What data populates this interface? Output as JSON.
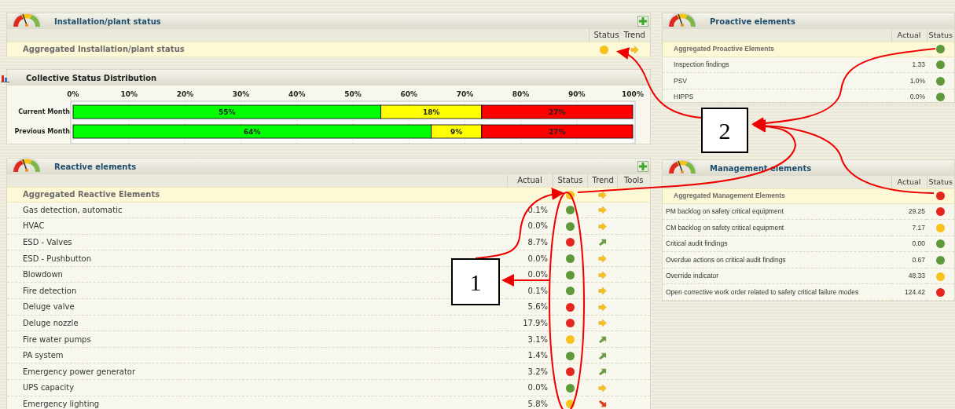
{
  "installation": {
    "title": "Installation/plant status",
    "columns": [
      "Status",
      "Trend"
    ],
    "rows": [
      {
        "name": "Aggregated Installation/plant status",
        "color": "#f7c21b",
        "trend": {
          "kind": "right"
        }
      }
    ]
  },
  "distribution": {
    "title": "Collective Status Distribution",
    "chart_data": {
      "type": "bar",
      "orientation": "horizontal",
      "stacked": true,
      "grid": true,
      "categories": [
        "Current Month",
        "Previous Month"
      ],
      "series": [
        {
          "color": "#00ff00",
          "values": [
            55,
            64
          ]
        },
        {
          "color": "#ffff00",
          "values": [
            18,
            9
          ]
        },
        {
          "color": "#ff0000",
          "values": [
            27,
            27
          ]
        }
      ],
      "xlim": [
        0,
        100
      ],
      "xticks": [
        {
          "value": 0,
          "label": "0%"
        },
        {
          "value": 10,
          "label": "10%"
        },
        {
          "value": 20,
          "label": "20%"
        },
        {
          "value": 30,
          "label": "30%"
        },
        {
          "value": 40,
          "label": "40%"
        },
        {
          "value": 50,
          "label": "50%"
        },
        {
          "value": 60,
          "label": "60%"
        },
        {
          "value": 70,
          "label": "70%"
        },
        {
          "value": 80,
          "label": "80%"
        },
        {
          "value": 90,
          "label": "90%"
        },
        {
          "value": 100,
          "label": "100%"
        }
      ],
      "value_labels": [
        [
          "55%",
          "64%"
        ],
        [
          "18%",
          "9%"
        ],
        [
          "27%",
          "27%"
        ]
      ]
    }
  },
  "reactive": {
    "title": "Reactive elements",
    "columns": [
      "Actual",
      "Status",
      "Trend",
      "Tools"
    ],
    "aggregate": {
      "name": "Aggregated Reactive Elements",
      "color": "#f7c21b",
      "trend": {
        "kind": "right"
      }
    },
    "rows": [
      {
        "name": "Gas detection, automatic",
        "actual": "0.1%",
        "color": "#5e9a3a",
        "trend": {
          "kind": "right"
        }
      },
      {
        "name": "HVAC",
        "actual": "0.0%",
        "color": "#5e9a3a",
        "trend": {
          "kind": "right"
        }
      },
      {
        "name": "ESD - Valves",
        "actual": "8.7%",
        "color": "#e5261c",
        "trend": {
          "kind": "up"
        }
      },
      {
        "name": "ESD - Pushbutton",
        "actual": "0.0%",
        "color": "#5e9a3a",
        "trend": {
          "kind": "right"
        }
      },
      {
        "name": "Blowdown",
        "actual": "0.0%",
        "color": "#5e9a3a",
        "trend": {
          "kind": "right"
        }
      },
      {
        "name": "Fire detection",
        "actual": "0.1%",
        "color": "#5e9a3a",
        "trend": {
          "kind": "right"
        }
      },
      {
        "name": "Deluge valve",
        "actual": "5.6%",
        "color": "#e5261c",
        "trend": {
          "kind": "right"
        }
      },
      {
        "name": "Deluge nozzle",
        "actual": "17.9%",
        "color": "#e5261c",
        "trend": {
          "kind": "right"
        }
      },
      {
        "name": "Fire water pumps",
        "actual": "3.1%",
        "color": "#f7c21b",
        "trend": {
          "kind": "up"
        }
      },
      {
        "name": "PA system",
        "actual": "1.4%",
        "color": "#5e9a3a",
        "trend": {
          "kind": "up"
        }
      },
      {
        "name": "Emergency power generator",
        "actual": "3.2%",
        "color": "#e5261c",
        "trend": {
          "kind": "up"
        }
      },
      {
        "name": "UPS capacity",
        "actual": "0.0%",
        "color": "#5e9a3a",
        "trend": {
          "kind": "right"
        }
      },
      {
        "name": "Emergency lighting",
        "actual": "5.8%",
        "color": "#f7c21b",
        "trend": {
          "kind": "down"
        }
      }
    ]
  },
  "proactive": {
    "title": "Proactive elements",
    "columns": [
      "Actual",
      "Status"
    ],
    "aggregate": {
      "name": "Aggregated Proactive Elements",
      "color": "#5e9a3a"
    },
    "rows": [
      {
        "name": "Inspection findings",
        "actual": "1.33",
        "color": "#5e9a3a"
      },
      {
        "name": "PSV",
        "actual": "1.0%",
        "color": "#5e9a3a"
      },
      {
        "name": "HIPPS",
        "actual": "0.0%",
        "color": "#5e9a3a"
      }
    ]
  },
  "management": {
    "title": "Management elements",
    "columns": [
      "Actual",
      "Status"
    ],
    "aggregate": {
      "name": "Aggregated Management Elements",
      "color": "#e5261c"
    },
    "rows": [
      {
        "name": "PM backlog on safety critical equipment",
        "actual": "29.25",
        "color": "#e5261c"
      },
      {
        "name": "CM backlog on safety critical equipment",
        "actual": "7.17",
        "color": "#f7c21b"
      },
      {
        "name": "Critical audit findings",
        "actual": "0.00",
        "color": "#5e9a3a"
      },
      {
        "name": "Overdue actions on critical audit findings",
        "actual": "0.67",
        "color": "#5e9a3a"
      },
      {
        "name": "Override indicator",
        "actual": "48.33",
        "color": "#f7c21b"
      },
      {
        "name": "Open corrective work order related to safety critical failure modes",
        "actual": "124.42",
        "color": "#e5261c"
      }
    ]
  },
  "callouts": [
    {
      "label": "1"
    },
    {
      "label": "2"
    }
  ]
}
